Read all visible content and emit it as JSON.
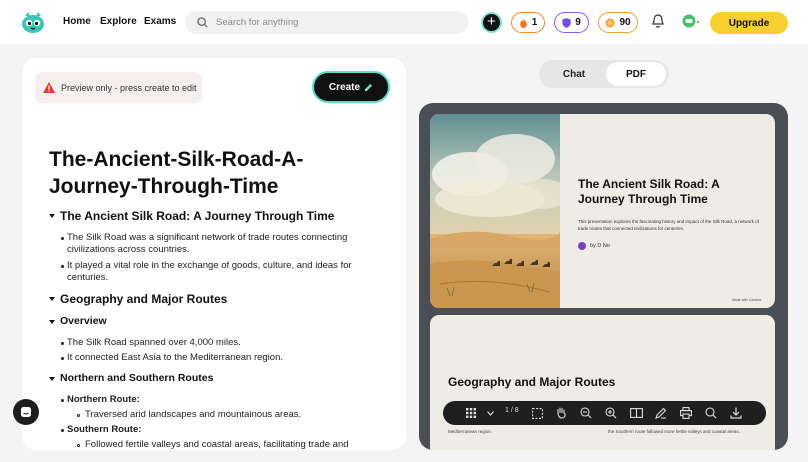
{
  "nav": {
    "home": "Home",
    "explore": "Explore",
    "exams": "Exams",
    "search_placeholder": "Search for anything",
    "streak_count": "1",
    "shield_count": "9",
    "coins_count": "90",
    "upgrade_label": "Upgrade"
  },
  "editor": {
    "preview_notice": "Preview only - press create to edit",
    "create_label": "Create",
    "doc_title": "The-Ancient-Silk-Road-A-Journey-Through-Time",
    "outline": {
      "h1_intro": "The Ancient Silk Road: A Journey Through Time",
      "intro_b1": "The Silk Road was a significant network of trade routes connecting civilizations across countries.",
      "intro_b2": "It played a vital role in the exchange of goods, culture, and ideas for centuries.",
      "h1_geo": "Geography and Major Routes",
      "h2_overview": "Overview",
      "overview_b1": "The Silk Road spanned over 4,000 miles.",
      "overview_b2": "It connected East Asia to the Mediterranean region.",
      "h2_routes": "Northern and Southern Routes",
      "northern_label": "Northern Route:",
      "northern_desc": "Traversed arid landscapes and mountainous areas.",
      "southern_label": "Southern Route:",
      "southern_desc": "Followed fertile valleys and coastal areas, facilitating trade and"
    }
  },
  "viewer": {
    "tab_chat": "Chat",
    "tab_pdf": "PDF",
    "active_tab": "PDF",
    "page_indicator": "1 / 8",
    "slide1": {
      "title": "The Ancient Silk Road: A Journey Through Time",
      "description": "This presentation explores the fascinating history and impact of the Silk Road, a network of trade routes that connected civilizations for centuries.",
      "byline": "by D No",
      "made_with": "Made with Gamma"
    },
    "slide2": {
      "title": "Geography and Major Routes",
      "left_fragment": "Mediterranean region.",
      "right_fragment": "the Southern route followed more fertile valleys and coastal areas."
    }
  },
  "colors": {
    "accent_teal": "#62dcc9",
    "upgrade_yellow": "#f7cf2e",
    "viewer_bg": "#4a4e55"
  }
}
